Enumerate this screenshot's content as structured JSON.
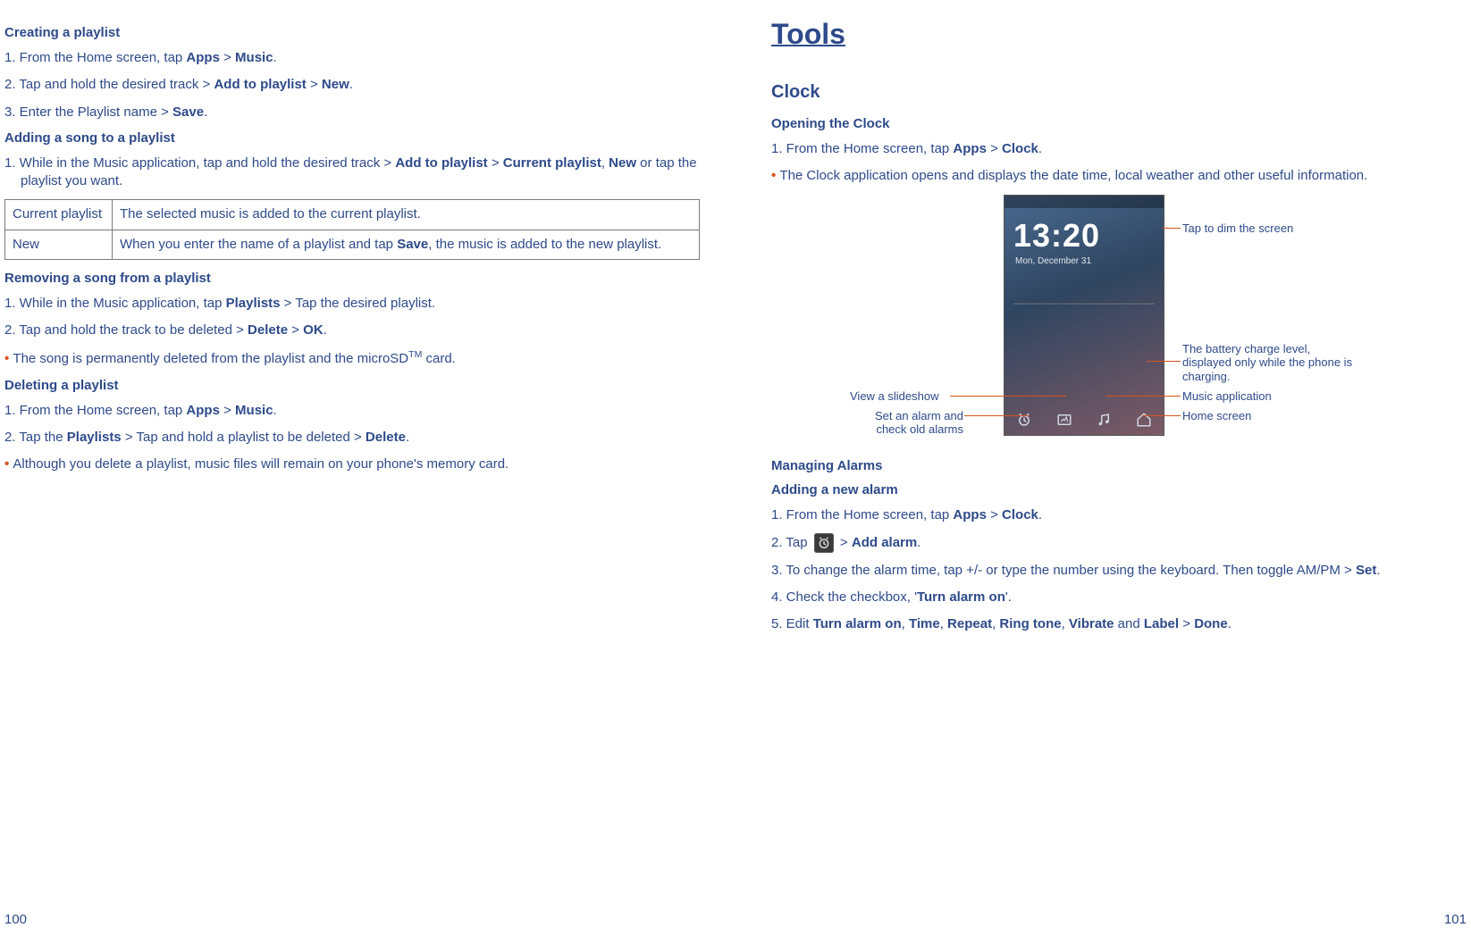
{
  "left": {
    "h_create": "Creating a playlist",
    "s1_1": "1. From the Home screen, tap ",
    "s1_1b1": "Apps",
    "s1_1m": " > ",
    "s1_1b2": "Music",
    "s1_1end": ".",
    "s1_2a": "2. Tap and hold the desired track > ",
    "s1_2b1": "Add to playlist",
    "s1_2m": " > ",
    "s1_2b2": "New",
    "s1_2end": ".",
    "s1_3a": "3. Enter the Playlist name > ",
    "s1_3b": "Save",
    "s1_3end": ".",
    "h_add": "Adding a song to a playlist",
    "s2_1a": "1. While in the Music application, tap and hold the desired track > ",
    "s2_1b1": "Add to playlist",
    "s2_1m": " > ",
    "s2_1b2": "Current playlist",
    "s2_1c": ", ",
    "s2_1b3": "New",
    "s2_1end": " or tap the playlist you want.",
    "tbl_r1c1": "Current playlist",
    "tbl_r1c2": "The selected music is added to the current playlist.",
    "tbl_r2c1": "New",
    "tbl_r2c2a": "When you enter the name of a playlist and tap ",
    "tbl_r2c2b": "Save",
    "tbl_r2c2c": ", the music is added to the new playlist.",
    "h_remove": "Removing a song from a playlist",
    "s3_1a": "1. While in the Music application, tap ",
    "s3_1b": "Playlists",
    "s3_1c": " > Tap the desired playlist.",
    "s3_2a": "2. Tap and hold the track to be deleted > ",
    "s3_2b1": "Delete",
    "s3_2m": " > ",
    "s3_2b2": "OK",
    "s3_2end": ".",
    "b3_1a": "The song is permanently deleted from the playlist and the microSD",
    "b3_1sup": "TM",
    "b3_1b": " card.",
    "h_delete": "Deleting a playlist",
    "s4_1a": "1. From the Home screen, tap ",
    "s4_1b1": "Apps",
    "s4_1m": " > ",
    "s4_1b2": "Music",
    "s4_1end": ".",
    "s4_2a": "2. Tap the ",
    "s4_2b1": "Playlists",
    "s4_2m": " > Tap and hold a playlist to be deleted > ",
    "s4_2b2": "Delete",
    "s4_2end": ".",
    "b4_1": "Although you delete a playlist, music files will remain on your phone's memory card.",
    "page_num": "100"
  },
  "right": {
    "title": "Tools",
    "h_clock": "Clock",
    "h_open": "Opening the Clock",
    "s1_1a": "1. From the Home screen, tap ",
    "s1_1b1": "Apps",
    "s1_1m": " > ",
    "s1_1b2": "Clock",
    "s1_1end": ".",
    "b1_1": "The Clock application opens and displays the date time, local weather and other useful information.",
    "fig": {
      "time": "13:20",
      "date": "Mon, December 31",
      "annot_dim": "Tap to dim the screen",
      "annot_batt": "The battery charge level, displayed only while the phone is charging.",
      "annot_slide": "View a slideshow",
      "annot_music": "Music application",
      "annot_alarm": "Set an alarm and check old alarms",
      "annot_home": "Home screen"
    },
    "h_manage": "Managing Alarms",
    "h_addnew": "Adding a new alarm",
    "s2_1a": "1. From the Home screen, tap ",
    "s2_1b1": "Apps",
    "s2_1m": " > ",
    "s2_1b2": "Clock",
    "s2_1end": ".",
    "s2_2a": "2. Tap ",
    "s2_2m": " > ",
    "s2_2b": "Add alarm",
    "s2_2end": ".",
    "s2_3a": "3. To change the alarm time, tap +/- or type the number using the keyboard. Then toggle AM/PM > ",
    "s2_3b": "Set",
    "s2_3end": ".",
    "s2_4a": "4. Check the checkbox, '",
    "s2_4b": "Turn alarm on",
    "s2_4c": "'.",
    "s2_5a": "5. Edit ",
    "s2_5b1": "Turn alarm on",
    "s2_5c1": ", ",
    "s2_5b2": "Time",
    "s2_5c2": ", ",
    "s2_5b3": "Repeat",
    "s2_5c3": ", ",
    "s2_5b4": "Ring tone",
    "s2_5c4": ", ",
    "s2_5b5": "Vibrate",
    "s2_5c5": " and ",
    "s2_5b6": "Label",
    "s2_5c6": " > ",
    "s2_5b7": "Done",
    "s2_5end": ".",
    "page_num": "101"
  }
}
